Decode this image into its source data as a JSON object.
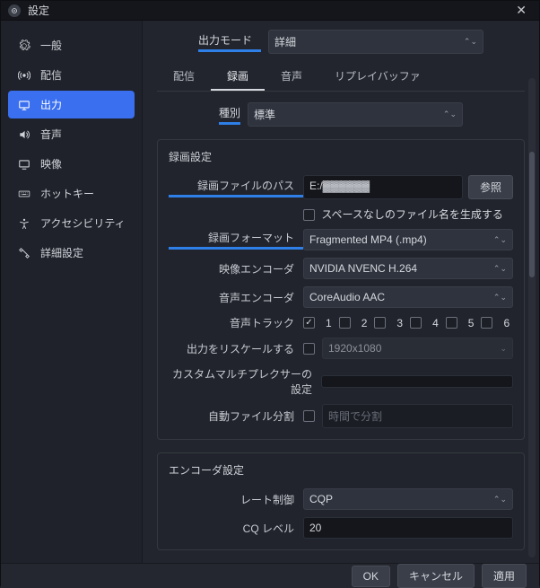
{
  "title": "設定",
  "sidebar": [
    "一般",
    "配信",
    "出力",
    "音声",
    "映像",
    "ホットキー",
    "アクセシビリティ",
    "詳細設定"
  ],
  "sidebar_active": 2,
  "output_mode_label": "出力モード",
  "output_mode_value": "詳細",
  "tabs": [
    "配信",
    "録画",
    "音声",
    "リプレイバッファ"
  ],
  "tab_active": 1,
  "type_label": "種別",
  "type_value": "標準",
  "rec": {
    "title": "録画設定",
    "path_label": "録画ファイルのパス",
    "path_value": "E:/▓▓▓▓▓▓",
    "browse": "参照",
    "nospace_label": "スペースなしのファイル名を生成する",
    "format_label": "録画フォーマット",
    "format_value": "Fragmented MP4 (.mp4)",
    "venc_label": "映像エンコーダ",
    "venc_value": "NVIDIA NVENC H.264",
    "aenc_label": "音声エンコーダ",
    "aenc_value": "CoreAudio AAC",
    "tracks_label": "音声トラック",
    "tracks": [
      "1",
      "2",
      "3",
      "4",
      "5",
      "6"
    ],
    "tracks_checked": [
      true,
      false,
      false,
      false,
      false,
      false
    ],
    "rescale_label": "出力をリスケールする",
    "rescale_value": "1920x1080",
    "mux_label": "カスタムマルチプレクサーの設定",
    "split_label": "自動ファイル分割",
    "split_value": "時間で分割"
  },
  "enc": {
    "title": "エンコーダ設定",
    "rc_label": "レート制御",
    "rc_value": "CQP",
    "cq_label": "CQ レベル",
    "cq_value": "20"
  },
  "footer": {
    "ok": "OK",
    "cancel": "キャンセル",
    "apply": "適用"
  }
}
